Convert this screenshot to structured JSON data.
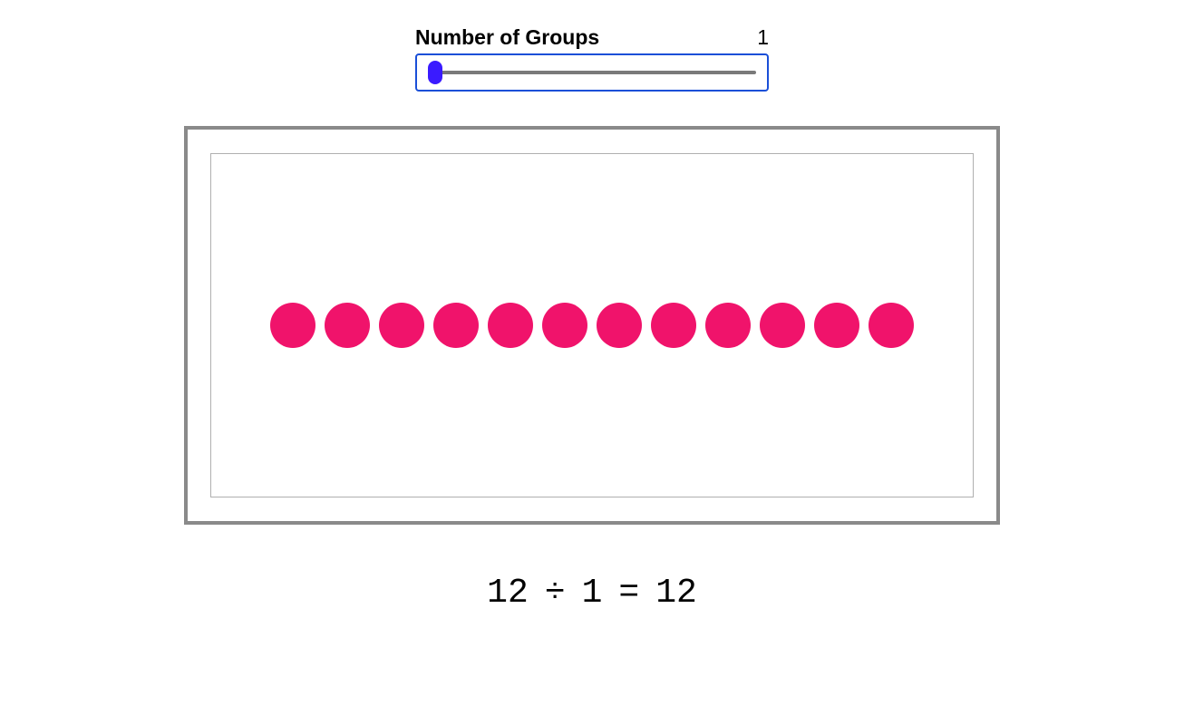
{
  "slider": {
    "label": "Number of Groups",
    "value": "1",
    "min": 1,
    "max": 12
  },
  "dots": {
    "count": 12,
    "color": "#f0136b"
  },
  "equation": {
    "dividend": "12",
    "op_div": "÷",
    "divisor": "1",
    "op_eq": "=",
    "quotient": "12"
  }
}
